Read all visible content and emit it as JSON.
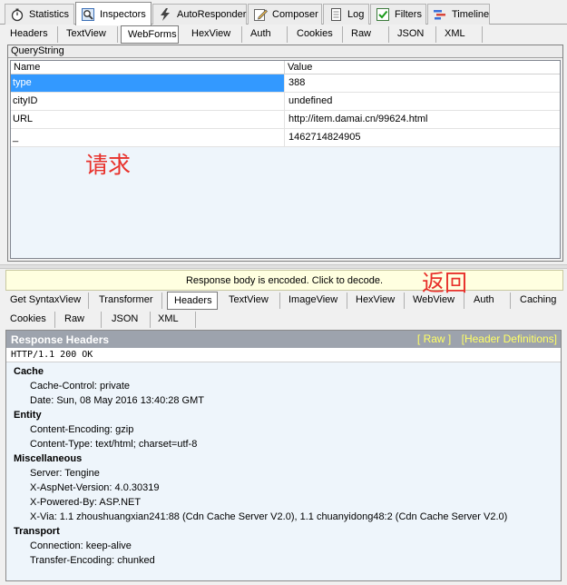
{
  "main_tabs": [
    {
      "label": "Statistics",
      "icon": "stopwatch-icon"
    },
    {
      "label": "Inspectors",
      "icon": "inspect-icon"
    },
    {
      "label": "AutoResponder",
      "icon": "lightning-icon"
    },
    {
      "label": "Composer",
      "icon": "compose-icon"
    },
    {
      "label": "Log",
      "icon": "log-icon"
    },
    {
      "label": "Filters",
      "icon": "checkbox-icon"
    },
    {
      "label": "Timeline",
      "icon": "timeline-icon"
    }
  ],
  "request_tabs": [
    "Headers",
    "TextView",
    "WebForms",
    "HexView",
    "Auth",
    "Cookies",
    "Raw",
    "JSON",
    "XML"
  ],
  "querystring": {
    "title": "QueryString",
    "col_name": "Name",
    "col_value": "Value",
    "rows": [
      {
        "name": "type",
        "value": "388"
      },
      {
        "name": "cityID",
        "value": "undefined"
      },
      {
        "name": "URL",
        "value": "http://item.damai.cn/99624.html"
      },
      {
        "name": "_",
        "value": "1462714824905"
      }
    ]
  },
  "annotations": {
    "request": "请求",
    "response": "返回",
    "color": "#e8312b"
  },
  "response": {
    "encoded_notice": "Response body is encoded. Click to decode.",
    "tabs_row1": [
      "Get SyntaxView",
      "Transformer",
      "Headers",
      "TextView",
      "ImageView",
      "HexView",
      "WebView",
      "Auth",
      "Caching"
    ],
    "tabs_row2": [
      "Cookies",
      "Raw",
      "JSON",
      "XML"
    ],
    "header_title": "Response Headers",
    "raw_link": "[ Raw ]",
    "defs_link": "[Header Definitions]",
    "status_line": "HTTP/1.1 200 OK",
    "groups": [
      {
        "title": "Cache",
        "items": [
          "Cache-Control: private",
          "Date: Sun, 08 May 2016 13:40:28 GMT"
        ]
      },
      {
        "title": "Entity",
        "items": [
          "Content-Encoding: gzip",
          "Content-Type: text/html; charset=utf-8"
        ]
      },
      {
        "title": "Miscellaneous",
        "items": [
          "Server: Tengine",
          "X-AspNet-Version: 4.0.30319",
          "X-Powered-By: ASP.NET",
          "X-Via: 1.1 zhoushuangxian241:88 (Cdn Cache Server V2.0), 1.1 chuanyidong48:2 (Cdn Cache Server V2.0)"
        ]
      },
      {
        "title": "Transport",
        "items": [
          "Connection: keep-alive",
          "Transfer-Encoding: chunked"
        ]
      }
    ]
  },
  "colors": {
    "selection": "#3399ff",
    "header_band": "#9da3ad",
    "link": "#ffff66",
    "notice_bg": "#ffffe0"
  }
}
